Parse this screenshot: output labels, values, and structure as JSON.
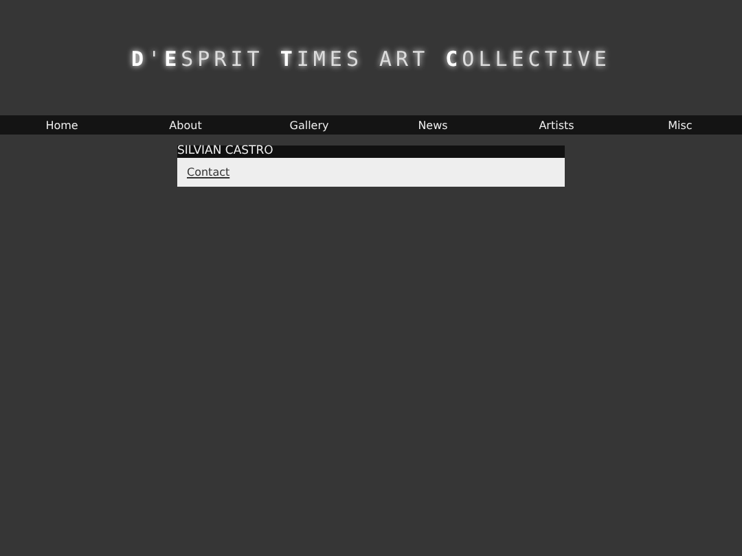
{
  "site_title": "**D**'**E**SPRIT **T**IMES ART **C**OLLECTIVE",
  "nav": [
    {
      "label": "Home"
    },
    {
      "label": "About"
    },
    {
      "label": "Gallery"
    },
    {
      "label": "News"
    },
    {
      "label": "Artists"
    },
    {
      "label": "Misc"
    }
  ],
  "panel": {
    "heading": "SILVIAN CASTRO",
    "links": [
      "Contact"
    ]
  }
}
